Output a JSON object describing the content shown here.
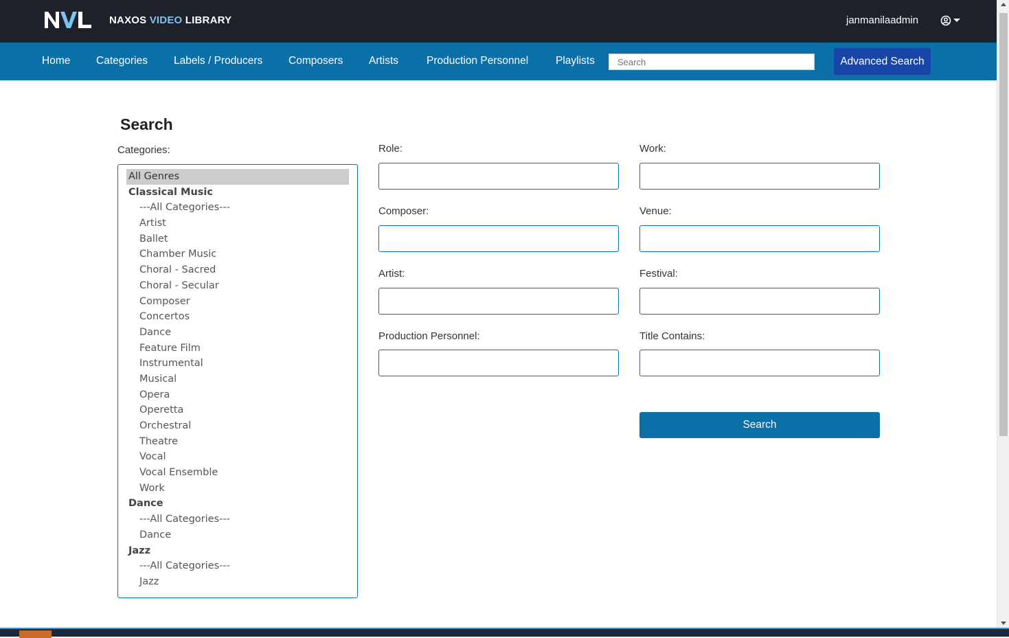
{
  "header": {
    "logo_text": "NVL",
    "brand_prefix": "NAXOS ",
    "brand_accent": "VIDEO",
    "brand_suffix": " LIBRARY",
    "username": "janmanilaadmin",
    "user_icon": "user-circle-icon"
  },
  "nav": {
    "items": [
      "Home",
      "Categories",
      "Labels / Producers",
      "Composers",
      "Artists",
      "Production Personnel",
      "Playlists"
    ],
    "search_placeholder": "Search",
    "advanced_search_label": "Advanced Search"
  },
  "main": {
    "title": "Search",
    "categories_label": "Categories:",
    "categories": [
      {
        "label": "All Genres",
        "kind": "selected"
      },
      {
        "label": "Classical Music",
        "kind": "group"
      },
      {
        "label": "---All Categories---",
        "kind": "sub"
      },
      {
        "label": "Artist",
        "kind": "sub"
      },
      {
        "label": "Ballet",
        "kind": "sub"
      },
      {
        "label": "Chamber Music",
        "kind": "sub"
      },
      {
        "label": "Choral - Sacred",
        "kind": "sub"
      },
      {
        "label": "Choral - Secular",
        "kind": "sub"
      },
      {
        "label": "Composer",
        "kind": "sub"
      },
      {
        "label": "Concertos",
        "kind": "sub"
      },
      {
        "label": "Dance",
        "kind": "sub"
      },
      {
        "label": "Feature Film",
        "kind": "sub"
      },
      {
        "label": "Instrumental",
        "kind": "sub"
      },
      {
        "label": "Musical",
        "kind": "sub"
      },
      {
        "label": "Opera",
        "kind": "sub"
      },
      {
        "label": "Operetta",
        "kind": "sub"
      },
      {
        "label": "Orchestral",
        "kind": "sub"
      },
      {
        "label": "Theatre",
        "kind": "sub"
      },
      {
        "label": "Vocal",
        "kind": "sub"
      },
      {
        "label": "Vocal Ensemble",
        "kind": "sub"
      },
      {
        "label": "Work",
        "kind": "sub"
      },
      {
        "label": "Dance",
        "kind": "group"
      },
      {
        "label": "---All Categories---",
        "kind": "sub"
      },
      {
        "label": "Dance",
        "kind": "sub"
      },
      {
        "label": "Jazz",
        "kind": "group"
      },
      {
        "label": "---All Categories---",
        "kind": "sub"
      },
      {
        "label": "Jazz",
        "kind": "sub"
      }
    ],
    "fields": {
      "role": {
        "label": "Role:",
        "value": ""
      },
      "work": {
        "label": "Work:",
        "value": ""
      },
      "composer": {
        "label": "Composer:",
        "value": ""
      },
      "venue": {
        "label": "Venue:",
        "value": ""
      },
      "artist": {
        "label": "Artist:",
        "value": ""
      },
      "festival": {
        "label": "Festival:",
        "value": ""
      },
      "production_personnel": {
        "label": "Production Personnel:",
        "value": ""
      },
      "title_contains": {
        "label": "Title Contains:",
        "value": ""
      }
    },
    "search_button_label": "Search"
  },
  "colors": {
    "topbar": "#1e2129",
    "navbar": "#0b6fa8",
    "advanced_button": "#1846a8",
    "accent_text": "#7ec3ef"
  }
}
